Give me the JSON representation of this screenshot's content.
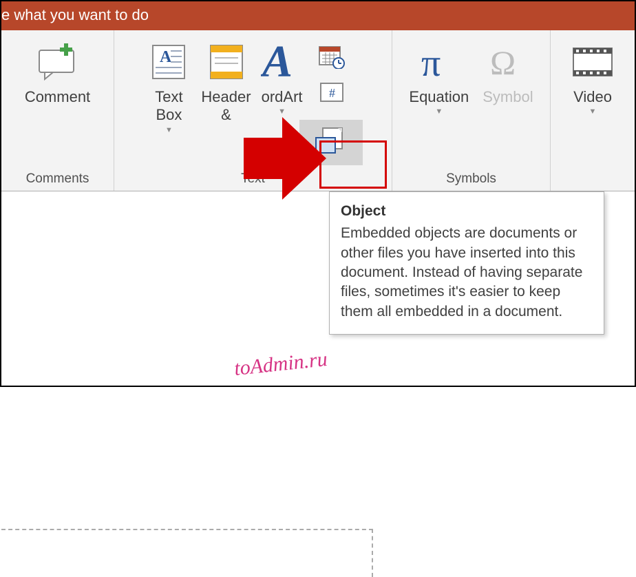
{
  "titlebar": {
    "text": "e what you want to do"
  },
  "groups": {
    "comments": {
      "label": "Comments",
      "comment_btn": "Comment"
    },
    "text": {
      "label": "Text",
      "textbox": "Text\nBox",
      "header": "Header\n&",
      "wordart": "ordArt",
      "wordart_full": "WordArt",
      "datetime": "Date & Time",
      "slidenum": "Slide Number",
      "object": "Object"
    },
    "symbols": {
      "label": "Symbols",
      "equation": "Equation",
      "symbol": "Symbol"
    },
    "media": {
      "video": "Video"
    }
  },
  "tooltip": {
    "title": "Object",
    "body": "Embedded objects are documents or other files you have inserted into this document. Instead of having separate files, sometimes it's easier to keep them all embedded in a document."
  },
  "watermark": "toAdmin.ru",
  "colors": {
    "accent": "#b7472a",
    "highlight": "#d40000",
    "wordart": "#2b579a",
    "equation": "#2b579a"
  }
}
